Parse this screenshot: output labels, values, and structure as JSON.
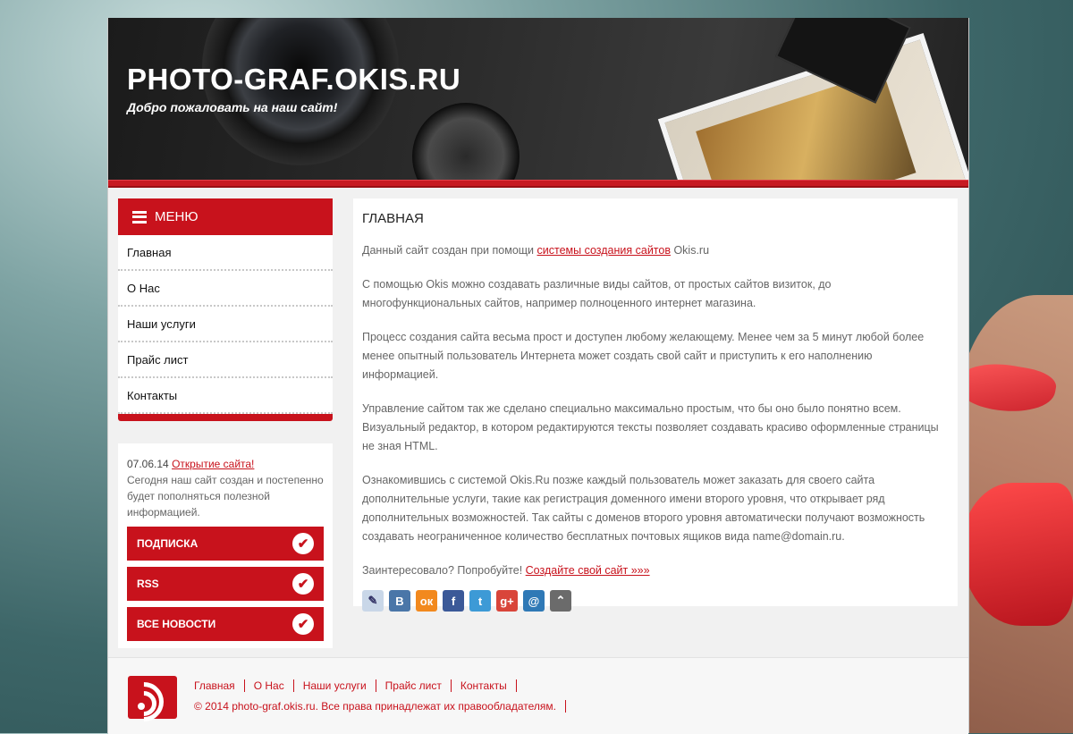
{
  "header": {
    "site_title": "PHOTO-GRAF.OKIS.RU",
    "subtitle": "Добро пожаловать на наш сайт!"
  },
  "menu": {
    "title": "Меню",
    "items": [
      {
        "label": "Главная"
      },
      {
        "label": "О Нас"
      },
      {
        "label": "Наши услуги"
      },
      {
        "label": "Прайс лист"
      },
      {
        "label": "Контакты"
      }
    ]
  },
  "news": {
    "date": "07.06.14",
    "link": "Открытие сайта!",
    "text": "Сегодня наш сайт создан и постепенно будет пополняться полезной информацией.",
    "buttons": [
      {
        "label": "Подписка"
      },
      {
        "label": "RSS"
      },
      {
        "label": "Все новости"
      }
    ]
  },
  "content": {
    "title": "Главная",
    "p1_before": "Данный сайт создан при помощи ",
    "p1_link": "системы создания сайтов",
    "p1_after": " Okis.ru",
    "p2": "С помощью Okis можно создавать различные виды сайтов, от простых сайтов визиток, до многофункциональных сайтов, например полноценного интернет магазина.",
    "p3": "Процесс создания сайта весьма прост и доступен любому желающему. Менее чем за 5 минут любой более менее опытный пользователь Интернета может создать свой сайт и приступить к его наполнению информацией.",
    "p4": "Управление сайтом так же сделано специально максимально простым, что бы оно было понятно всем. Визуальный редактор, в котором редактируются тексты позволяет создавать красиво оформленные страницы не зная HTML.",
    "p5": "Ознакомившись с системой Okis.Ru позже каждый пользователь может заказать для своего сайта дополнительные услуги, такие как регистрация доменного имени второго уровня, что открывает ряд дополнительных возможностей. Так сайты с доменов второго уровня автоматически получают возможность создавать неограниченное количество бесплатных почтовых ящиков вида name@domain.ru.",
    "p6_before": "Заинтересовало? Попробуйте! ",
    "p6_link": "Создайте свой сайт »»»",
    "share": [
      {
        "icon": "livejournal-icon",
        "glyph": "✎",
        "color": "#c9d7e8"
      },
      {
        "icon": "vkontakte-icon",
        "glyph": "В",
        "color": "#4a76a8"
      },
      {
        "icon": "odnoklassniki-icon",
        "glyph": "ок",
        "color": "#f2891e"
      },
      {
        "icon": "facebook-icon",
        "glyph": "f",
        "color": "#3b5998"
      },
      {
        "icon": "twitter-icon",
        "glyph": "t",
        "color": "#3d9ad6"
      },
      {
        "icon": "google-plus-icon",
        "glyph": "g+",
        "color": "#d9453a"
      },
      {
        "icon": "mail-ru-icon",
        "glyph": "@",
        "color": "#2f79b6"
      },
      {
        "icon": "more-icon",
        "glyph": "⌃",
        "color": "#6b6b6b"
      }
    ]
  },
  "footer": {
    "nav": [
      {
        "label": "Главная"
      },
      {
        "label": "О Нас"
      },
      {
        "label": "Наши услуги"
      },
      {
        "label": "Прайс лист"
      },
      {
        "label": "Контакты"
      }
    ],
    "copyright": "© 2014 photo-graf.okis.ru. Все права принадлежат их правообладателям."
  },
  "colors": {
    "accent": "#c8121c"
  }
}
